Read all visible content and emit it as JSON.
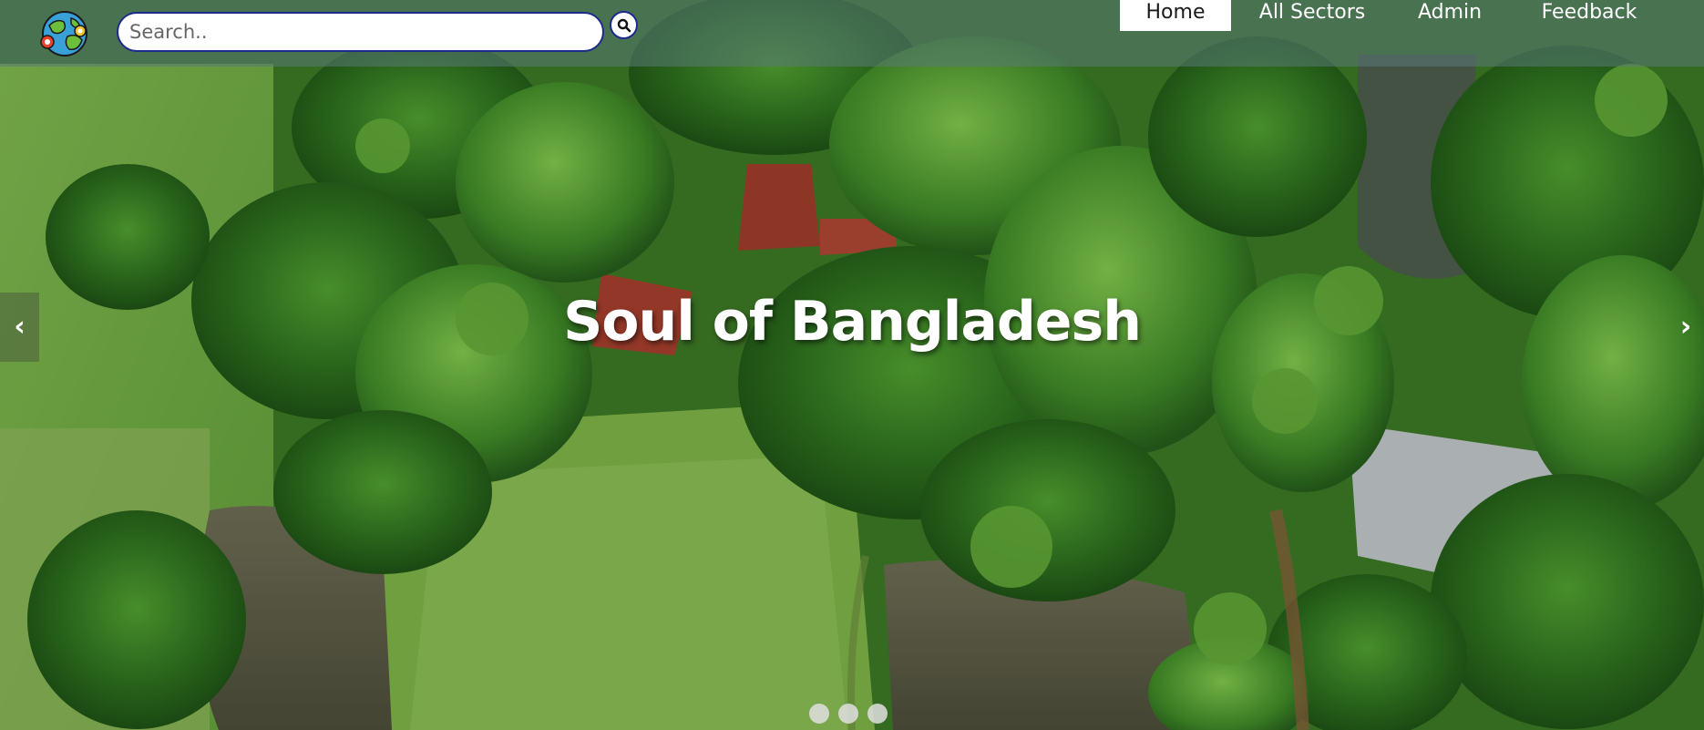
{
  "search": {
    "placeholder": "Search.."
  },
  "nav": {
    "items": [
      {
        "label": "Home",
        "active": true
      },
      {
        "label": "All Sectors",
        "active": false
      },
      {
        "label": "Admin",
        "active": false
      },
      {
        "label": "Feedback",
        "active": false
      }
    ]
  },
  "hero": {
    "title": "Soul of Bangladesh",
    "prev_arrow": "‹",
    "next_arrow": "›",
    "slide_count": 3
  },
  "icons": {
    "logo": "globe-logo-icon",
    "search": "search-icon"
  },
  "colors": {
    "navbar_overlay": "#5a7878",
    "search_border": "#1c2a8c",
    "active_nav_bg": "#ffffff",
    "title_text": "#ffffff"
  }
}
